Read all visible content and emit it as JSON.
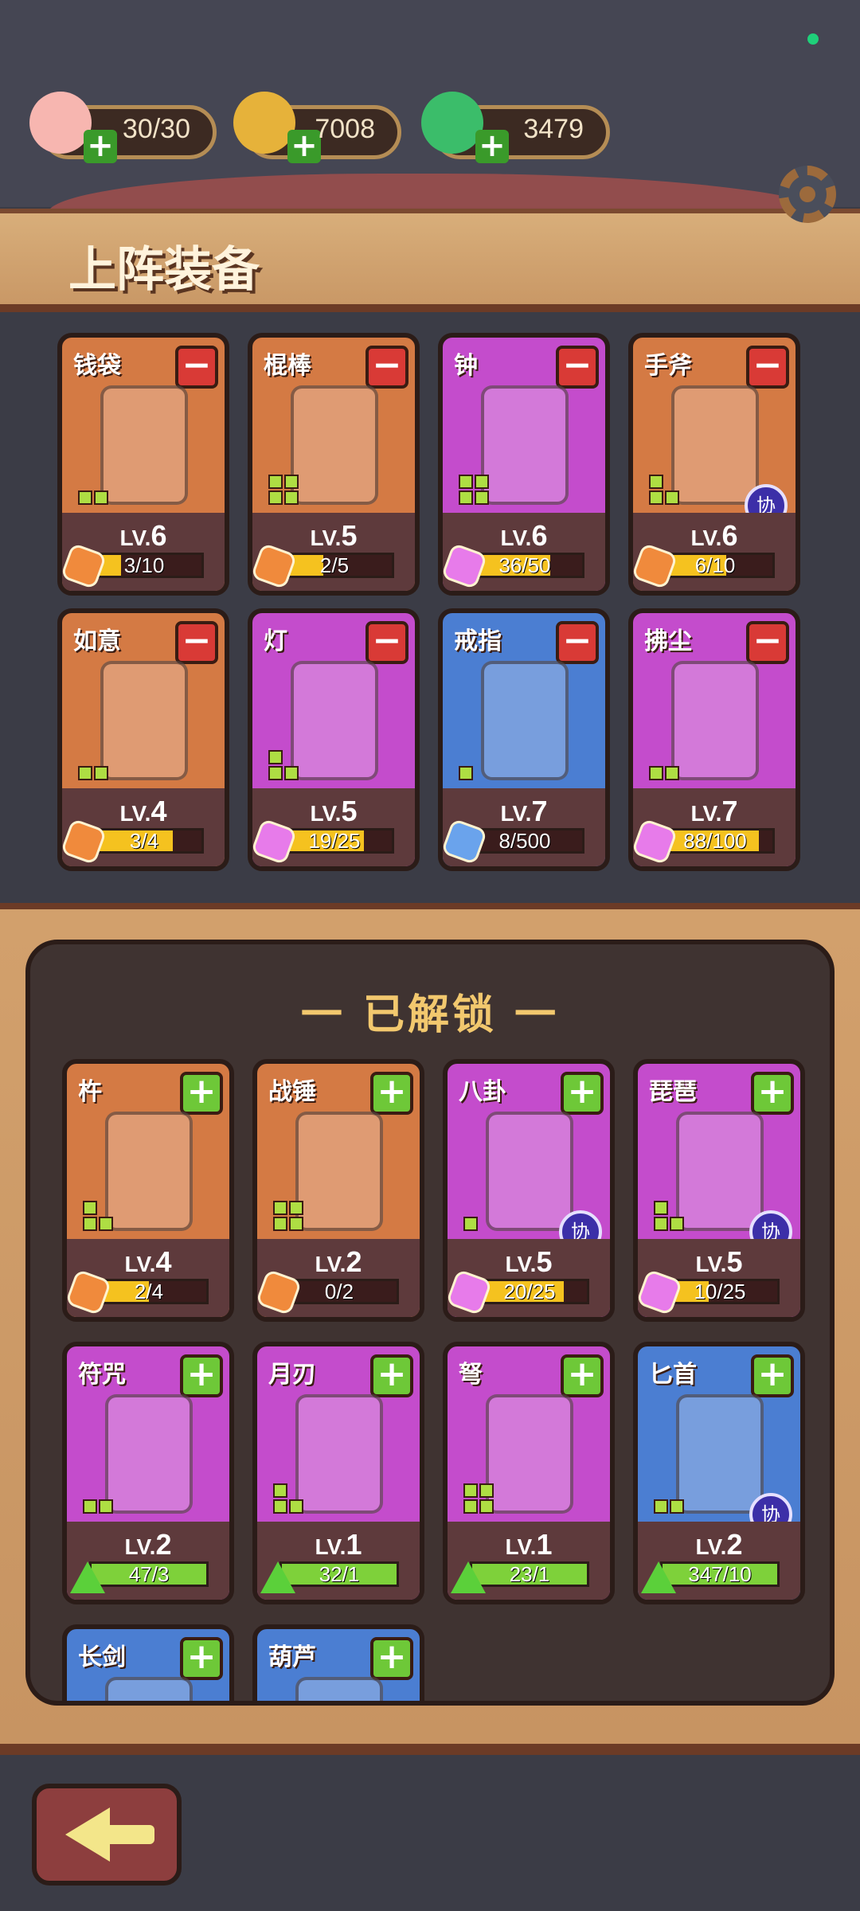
{
  "resources": [
    {
      "icon": "peach-icon",
      "value": "30/30",
      "color": "#f7b6b0"
    },
    {
      "icon": "gold-ruyi-icon",
      "value": "7008",
      "color": "#e6b23a"
    },
    {
      "icon": "jade-icon",
      "value": "3479",
      "color": "#3bbd6a"
    }
  ],
  "header": {
    "title": "上阵装备"
  },
  "equipped": [
    {
      "name": "钱袋",
      "color": "orange",
      "level": "6",
      "progress": "3/10",
      "fill": 0.3,
      "badge": "puzzle-orange",
      "pips": 2,
      "xie": false
    },
    {
      "name": "棍棒",
      "color": "orange",
      "level": "5",
      "progress": "2/5",
      "fill": 0.4,
      "badge": "puzzle-orange",
      "pips": 4,
      "xie": false
    },
    {
      "name": "钟",
      "color": "purple",
      "level": "6",
      "progress": "36/50",
      "fill": 0.72,
      "badge": "puzzle-purple",
      "pips": 4,
      "xie": false
    },
    {
      "name": "手斧",
      "color": "orange",
      "level": "6",
      "progress": "6/10",
      "fill": 0.6,
      "badge": "puzzle-orange",
      "pips": 3,
      "xie": true
    },
    {
      "name": "如意",
      "color": "orange",
      "level": "4",
      "progress": "3/4",
      "fill": 0.75,
      "badge": "puzzle-orange",
      "pips": 2,
      "xie": false
    },
    {
      "name": "灯",
      "color": "purple",
      "level": "5",
      "progress": "19/25",
      "fill": 0.76,
      "badge": "puzzle-purple",
      "pips": 3,
      "xie": false
    },
    {
      "name": "戒指",
      "color": "blue",
      "level": "7",
      "progress": "8/500",
      "fill": 0.02,
      "badge": "puzzle-blue",
      "pips": 1,
      "xie": false
    },
    {
      "name": "拂尘",
      "color": "purple",
      "level": "7",
      "progress": "88/100",
      "fill": 0.88,
      "badge": "puzzle-purple",
      "pips": 2,
      "xie": false
    }
  ],
  "unlocked_title": "一 已解锁 一",
  "unlocked": [
    {
      "name": "杵",
      "color": "orange",
      "level": "4",
      "progress": "2/4",
      "fill": 0.5,
      "badge": "puzzle-orange",
      "pips": 3,
      "xie": false,
      "green": false
    },
    {
      "name": "战锤",
      "color": "orange",
      "level": "2",
      "progress": "0/2",
      "fill": 0.0,
      "badge": "puzzle-orange",
      "pips": 4,
      "xie": false,
      "green": false
    },
    {
      "name": "八卦",
      "color": "purple",
      "level": "5",
      "progress": "20/25",
      "fill": 0.8,
      "badge": "puzzle-purple",
      "pips": 1,
      "xie": true,
      "green": false
    },
    {
      "name": "琵琶",
      "color": "purple",
      "level": "5",
      "progress": "10/25",
      "fill": 0.4,
      "badge": "puzzle-purple",
      "pips": 3,
      "xie": true,
      "green": false
    },
    {
      "name": "符咒",
      "color": "purple",
      "level": "2",
      "progress": "47/3",
      "fill": 1.0,
      "badge": "up",
      "pips": 2,
      "xie": false,
      "green": true
    },
    {
      "name": "月刃",
      "color": "purple",
      "level": "1",
      "progress": "32/1",
      "fill": 1.0,
      "badge": "up",
      "pips": 3,
      "xie": false,
      "green": true
    },
    {
      "name": "弩",
      "color": "purple",
      "level": "1",
      "progress": "23/1",
      "fill": 1.0,
      "badge": "up",
      "pips": 4,
      "xie": false,
      "green": true
    },
    {
      "name": "匕首",
      "color": "blue",
      "level": "2",
      "progress": "347/10",
      "fill": 1.0,
      "badge": "up",
      "pips": 2,
      "xie": true,
      "green": true
    },
    {
      "name": "长剑",
      "color": "blue",
      "level": "",
      "progress": "",
      "fill": 0,
      "badge": "",
      "pips": 0,
      "xie": false,
      "green": false
    },
    {
      "name": "葫芦",
      "color": "blue",
      "level": "",
      "progress": "",
      "fill": 0,
      "badge": "",
      "pips": 0,
      "xie": false,
      "green": false
    }
  ],
  "labels": {
    "lv": "LV.",
    "xie": "协",
    "minus": "−",
    "plus": "+"
  }
}
